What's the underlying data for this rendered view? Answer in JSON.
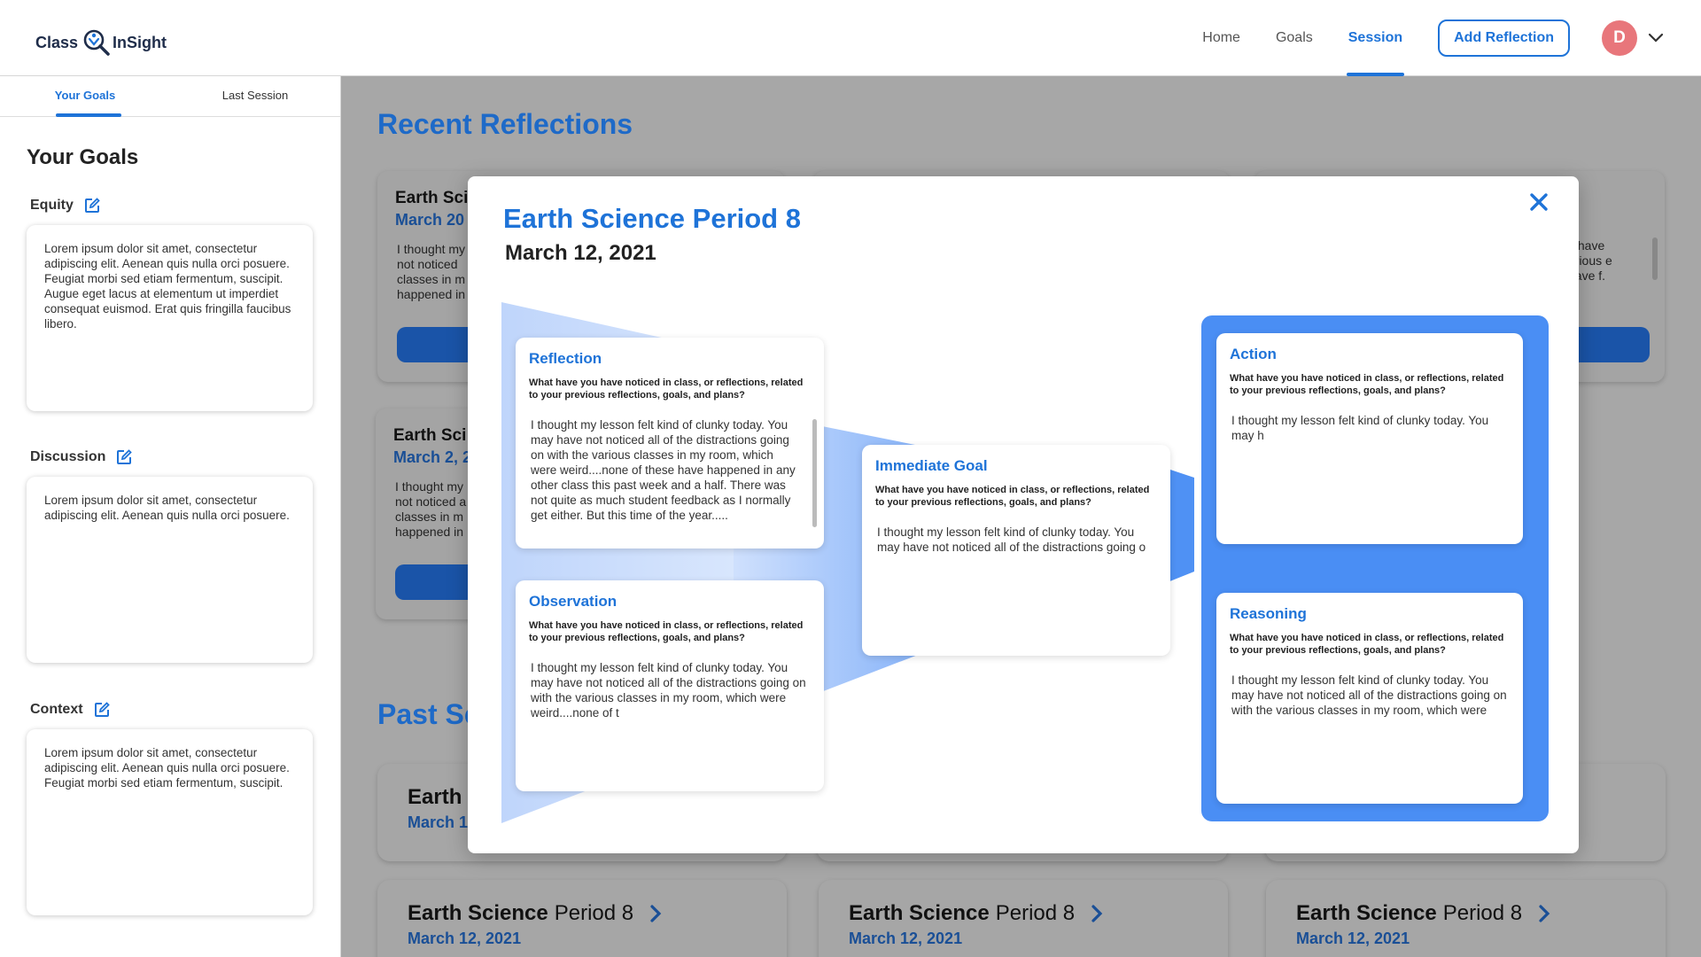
{
  "header": {
    "logo_left": "Class",
    "logo_right": "InSight",
    "nav": [
      "Home",
      "Goals",
      "Session"
    ],
    "active_nav": "Session",
    "add_button": "Add Reflection",
    "avatar_initial": "D",
    "accent_color": "#1e73d8"
  },
  "sidebar": {
    "tabs": [
      "Your Goals",
      "Last Session"
    ],
    "title": "Your Goals",
    "goals": [
      {
        "label": "Equity",
        "text": "Lorem ipsum dolor sit amet, consectetur adipiscing elit. Aenean quis nulla orci posuere. Feugiat morbi sed etiam fermentum, suscipit. Augue eget lacus at elementum ut imperdiet consequat euismod. Erat quis fringilla faucibus libero."
      },
      {
        "label": "Discussion",
        "text": "Lorem ipsum dolor sit amet, consectetur adipiscing elit. Aenean quis nulla orci posuere."
      },
      {
        "label": "Context",
        "text": "Lorem ipsum dolor sit amet, consectetur adipiscing elit. Aenean quis nulla orci posuere. Feugiat morbi sed etiam fermentum, suscipit."
      }
    ]
  },
  "main": {
    "recent_title": "Recent Reflections",
    "past_title": "Past Se",
    "recent_cards": [
      {
        "title": "Earth Sci",
        "date": "March 20",
        "text": "I thought my not noticed classes in m happened in"
      },
      {
        "title": "Earth Sci",
        "date": "March 2, 2",
        "text": "I thought my not noticed a classes in m happened in"
      },
      {
        "text": "y have arious e have f."
      }
    ],
    "past_cards": [
      {
        "title_bold": "Earth",
        "title_rest": "",
        "date": "March 1"
      },
      {
        "title_bold": "Earth Science",
        "title_rest": "Period 8",
        "date": "March 12, 2021"
      },
      {
        "title_bold": "Earth Science",
        "title_rest": "Period 8",
        "date": "March 12, 2021"
      },
      {
        "title_bold": "Earth Science",
        "title_rest": "Period 8",
        "date": "March 12, 2021"
      }
    ]
  },
  "modal": {
    "title": "Earth Science Period 8",
    "date": "March 12, 2021",
    "question": "What have you have noticed in class, or reflections, related to your previous reflections, goals, and plans?",
    "panels": {
      "reflection": {
        "heading": "Reflection",
        "answer": "I thought my lesson felt kind of clunky today. You may have not noticed all of the distractions going on with the various classes in my room, which were weird....none of these have happened in any other class this past week and a half.  There was not quite as much student feedback as I normally get either.  But this time of the year....."
      },
      "observation": {
        "heading": "Observation",
        "answer": "I thought my lesson felt kind of clunky today. You may have not noticed all of the distractions going on with the various classes in my room, which were weird....none of t"
      },
      "immediate_goal": {
        "heading": "Immediate Goal",
        "answer": "I thought my lesson felt kind of clunky today. You may have not noticed all of the distractions going o"
      },
      "action": {
        "heading": "Action",
        "answer": "I thought my lesson felt kind of clunky today. You may h"
      },
      "reasoning": {
        "heading": "Reasoning",
        "answer": "I thought my lesson felt kind of clunky today. You may have not noticed all of the distractions going on with the various classes in my room, which were"
      }
    }
  }
}
